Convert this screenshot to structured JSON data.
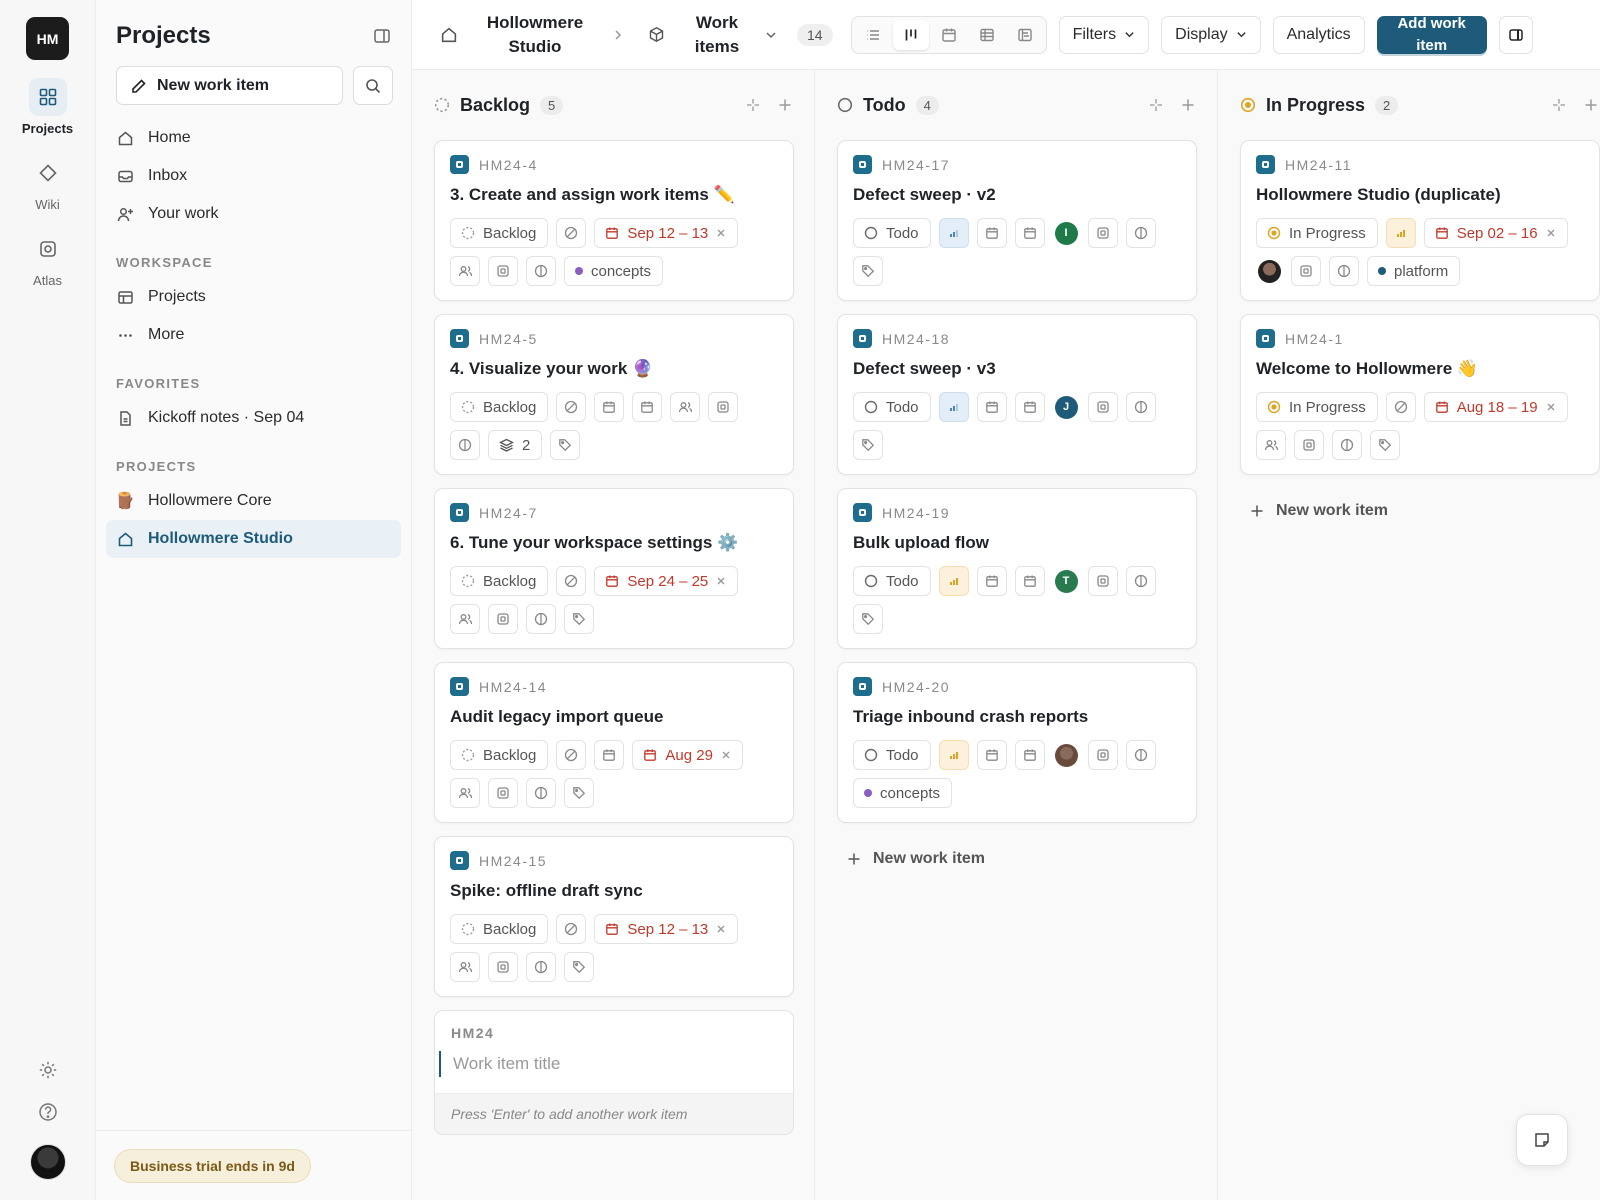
{
  "workspace": {
    "initials": "HM"
  },
  "rail": {
    "items": [
      {
        "label": "Projects",
        "icon": "grid-icon",
        "active": true
      },
      {
        "label": "Wiki",
        "icon": "diamond-icon",
        "active": false
      },
      {
        "label": "Atlas",
        "icon": "atlas-icon",
        "active": false
      }
    ]
  },
  "sidebar": {
    "title": "Projects",
    "new_item_label": "New work item",
    "nav": [
      {
        "label": "Home",
        "icon": "home-icon"
      },
      {
        "label": "Inbox",
        "icon": "inbox-icon"
      },
      {
        "label": "Your work",
        "icon": "user-plus-icon"
      }
    ],
    "workspace_label": "WORKSPACE",
    "workspace_items": [
      {
        "label": "Projects",
        "icon": "table-icon"
      },
      {
        "label": "More",
        "icon": "dots-icon"
      }
    ],
    "favorites_label": "FAVORITES",
    "favorites": [
      {
        "label": "Kickoff notes · Sep 04",
        "icon": "doc-icon"
      }
    ],
    "projects_label": "PROJECTS",
    "projects": [
      {
        "label": "Hollowmere Core",
        "icon": "emoji",
        "emoji": "🪵",
        "active": false
      },
      {
        "label": "Hollowmere Studio",
        "icon": "home-icon",
        "active": true
      }
    ],
    "trial": "Business trial ends in 9d"
  },
  "topbar": {
    "project": "Hollowmere Studio",
    "section": "Work items",
    "count": "14",
    "filters": "Filters",
    "display": "Display",
    "analytics": "Analytics",
    "add": "Add work item"
  },
  "columns": [
    {
      "title": "Backlog",
      "count": "5",
      "state": "backlog",
      "cards": [
        {
          "id": "HM24-4",
          "title": "3. Create and assign work items ✏️",
          "state": "Backlog",
          "date": "Sep 12 – 13",
          "label": "concepts",
          "label_color": "#8b5fbf",
          "row1": [
            "state",
            "none",
            "date"
          ],
          "row2": [
            "members",
            "module",
            "estimate",
            "label"
          ]
        },
        {
          "id": "HM24-5",
          "title": "4. Visualize your work 🔮",
          "state": "Backlog",
          "row1": [
            "state",
            "none",
            "cal",
            "cal",
            "members",
            "module"
          ],
          "row2": [
            "estimate",
            "sub",
            "tag"
          ],
          "sub_count": "2"
        },
        {
          "id": "HM24-7",
          "title": "6. Tune your workspace settings ⚙️",
          "state": "Backlog",
          "date": "Sep 24 – 25",
          "row1": [
            "state",
            "none",
            "date"
          ],
          "row2": [
            "members",
            "module",
            "estimate",
            "tag"
          ]
        },
        {
          "id": "HM24-14",
          "title": "Audit legacy import queue",
          "state": "Backlog",
          "date": "Aug 29",
          "row1": [
            "state",
            "none",
            "cal",
            "date"
          ],
          "row2": [
            "members",
            "module",
            "estimate",
            "tag"
          ]
        },
        {
          "id": "HM24-15",
          "title": "Spike: offline draft sync",
          "state": "Backlog",
          "date": "Sep 12 – 13",
          "row1": [
            "state",
            "none",
            "date"
          ],
          "row2": [
            "members",
            "module",
            "estimate",
            "tag"
          ]
        }
      ],
      "draft": {
        "id": "HM24",
        "placeholder": "Work item title",
        "hint": "Press 'Enter' to add another work item"
      }
    },
    {
      "title": "Todo",
      "count": "4",
      "state": "todo",
      "cards": [
        {
          "id": "HM24-17",
          "title": "Defect sweep · v2",
          "state": "Todo",
          "priority": "low",
          "avatar": "I",
          "avatar_color": "#1f7a4a",
          "row1": [
            "state",
            "priority",
            "cal",
            "cal",
            "avatar",
            "module",
            "estimate"
          ],
          "row2": [
            "tag"
          ]
        },
        {
          "id": "HM24-18",
          "title": "Defect sweep · v3",
          "state": "Todo",
          "priority": "low",
          "avatar": "J",
          "avatar_color": "#1e5b7a",
          "row1": [
            "state",
            "priority",
            "cal",
            "cal",
            "avatar",
            "module",
            "estimate"
          ],
          "row2": [
            "tag"
          ]
        },
        {
          "id": "HM24-19",
          "title": "Bulk upload flow",
          "state": "Todo",
          "priority": "medium",
          "avatar": "T",
          "avatar_color": "#2a7a4f",
          "row1": [
            "state",
            "priority",
            "cal",
            "cal",
            "avatar",
            "module",
            "estimate"
          ],
          "row2": [
            "tag"
          ]
        },
        {
          "id": "HM24-20",
          "title": "Triage inbound crash reports",
          "state": "Todo",
          "priority": "medium",
          "avatar": "",
          "avatar_color": "#6a4a3a",
          "label": "concepts",
          "label_color": "#8b5fbf",
          "row1": [
            "state",
            "priority",
            "cal",
            "cal",
            "avatar",
            "module",
            "estimate"
          ],
          "row2": [
            "label"
          ]
        }
      ],
      "add_label": "New work item"
    },
    {
      "title": "In Progress",
      "count": "2",
      "state": "progress",
      "cards": [
        {
          "id": "HM24-11",
          "title": "Hollowmere Studio (duplicate)",
          "state": "In Progress",
          "priority": "medium",
          "date": "Sep 02 – 16",
          "avatar": "",
          "avatar_color": "#222222",
          "label": "platform",
          "label_color": "#1e5b7a",
          "row1": [
            "state",
            "priority",
            "date"
          ],
          "row2": [
            "avatar",
            "module",
            "estimate",
            "label"
          ]
        },
        {
          "id": "HM24-1",
          "title": "Welcome to Hollowmere 👋",
          "state": "In Progress",
          "date": "Aug 18 – 19",
          "row1": [
            "state",
            "none",
            "date"
          ],
          "row2": [
            "members",
            "module",
            "estimate",
            "tag"
          ]
        }
      ],
      "add_label": "New work item"
    }
  ]
}
